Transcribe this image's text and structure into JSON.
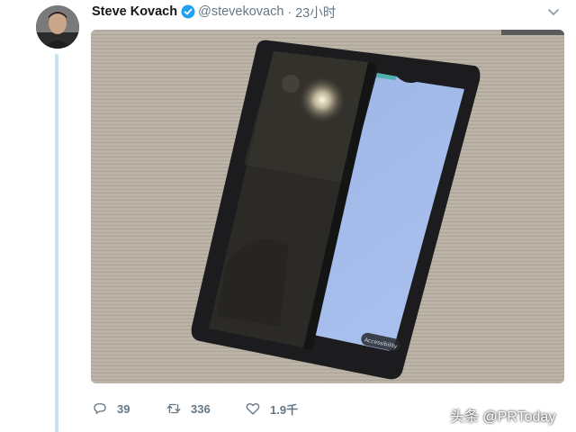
{
  "tweet": {
    "display_name": "Steve Kovach",
    "handle": "@stevekovach",
    "separator": "·",
    "time": "23小时",
    "verified": true
  },
  "icons": {
    "verified": "verified-badge-icon",
    "caret": "chevron-down-icon",
    "reply": "reply-icon",
    "retweet": "retweet-icon",
    "like": "heart-icon"
  },
  "actions": {
    "reply_count": "39",
    "retweet_count": "336",
    "like_count": "1.9千"
  },
  "watermark": {
    "text": "头条 @PRToday"
  },
  "photo": {
    "on_screen_button": "Accessibility"
  },
  "colors": {
    "accent": "#1da1f2",
    "muted": "#657786",
    "thread_line": "#c4e4f6"
  }
}
